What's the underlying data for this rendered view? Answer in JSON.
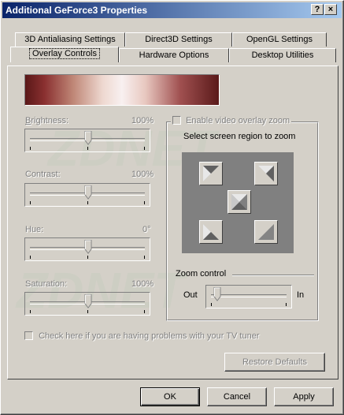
{
  "window": {
    "title": "Additional GeForce3 Properties",
    "help_label": "?",
    "close_label": "×"
  },
  "tabs_row1": [
    "3D Antialiasing Settings",
    "Direct3D Settings",
    "OpenGL Settings"
  ],
  "tabs_row2": [
    "Overlay Controls",
    "Hardware Options",
    "Desktop Utilities"
  ],
  "active_tab": "Overlay Controls",
  "sliders": [
    {
      "label": "Brightness:",
      "value": "100%",
      "position": 0.5
    },
    {
      "label": "Contrast:",
      "value": "100%",
      "position": 0.5
    },
    {
      "label": "Hue:",
      "value": "0°",
      "position": 0.5
    },
    {
      "label": "Saturation:",
      "value": "100%",
      "position": 0.5
    }
  ],
  "zoom": {
    "enable_label": "Enable video overlay zoom",
    "enabled": false,
    "region_label": "Select screen region to zoom",
    "control_label": "Zoom control",
    "out_label": "Out",
    "in_label": "In",
    "level": 0.1
  },
  "tv_tuner_label": "Check here if you are having problems with your TV tuner",
  "tv_tuner_checked": false,
  "restore_label": "Restore Defaults",
  "buttons": {
    "ok": "OK",
    "cancel": "Cancel",
    "apply": "Apply"
  },
  "watermark": "ZDNET"
}
